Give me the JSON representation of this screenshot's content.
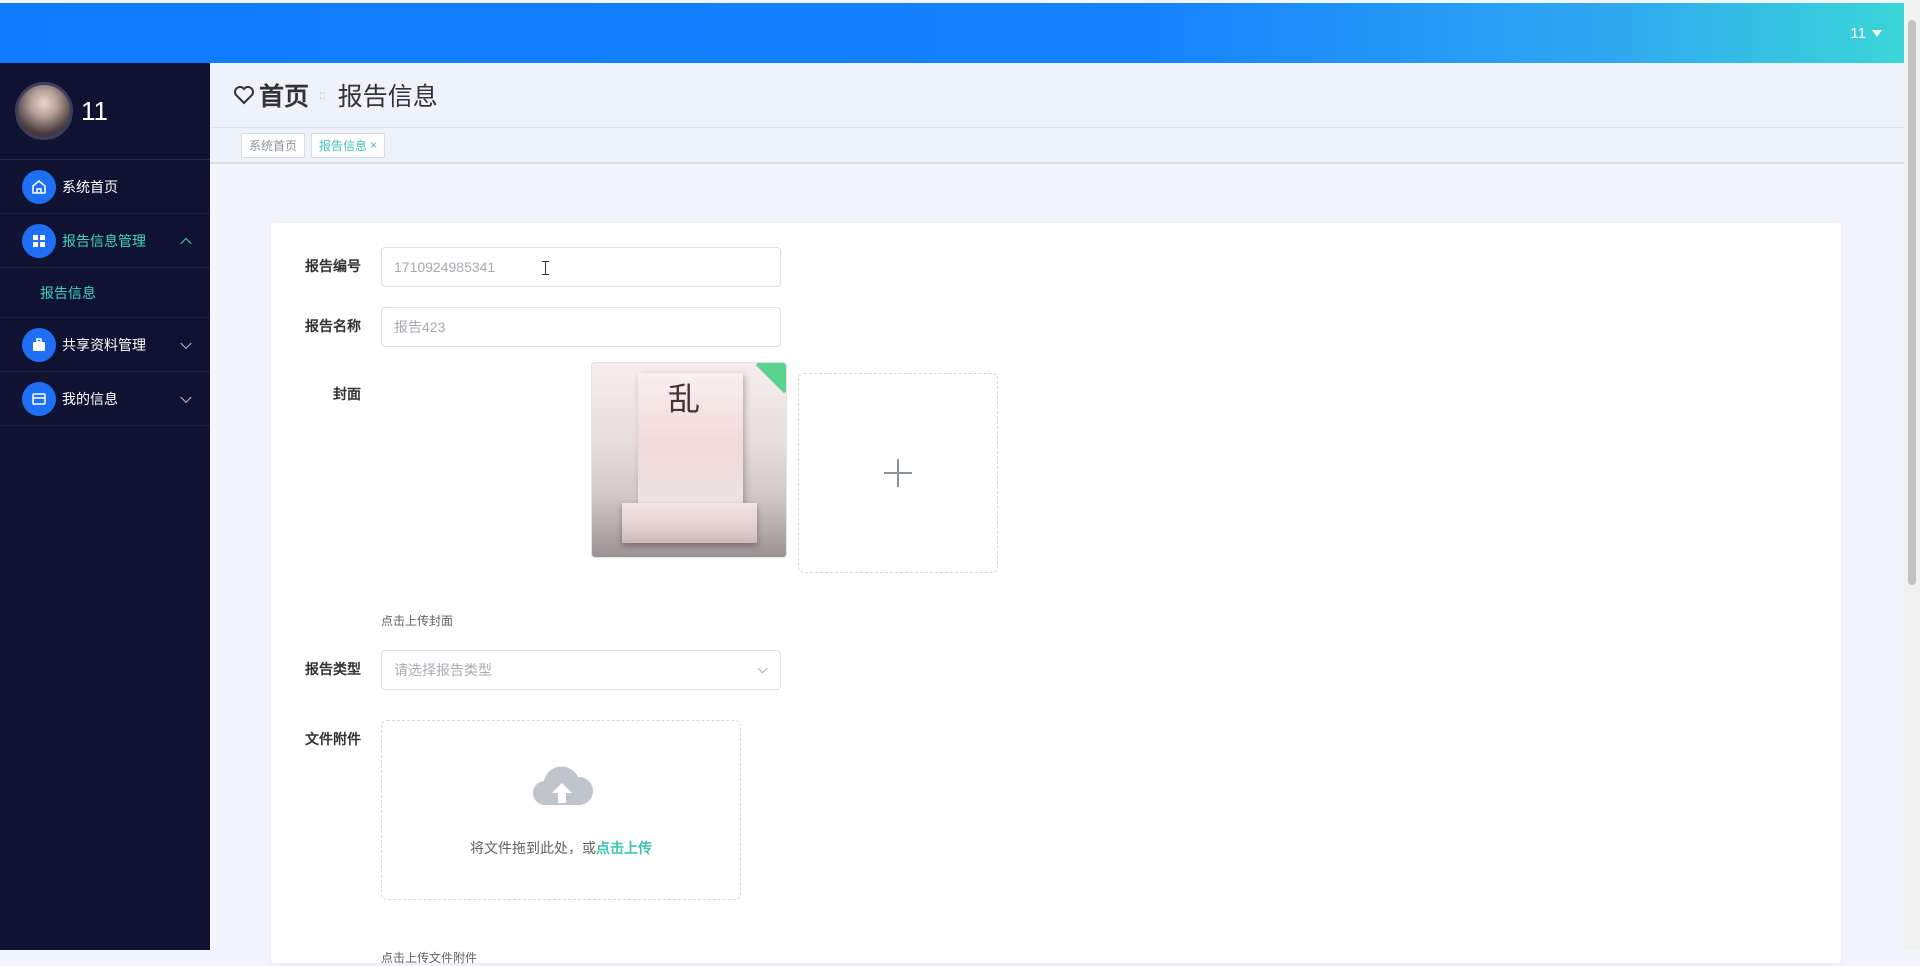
{
  "topbar": {
    "user": "11"
  },
  "sidebar": {
    "profile_name": "11",
    "items": [
      {
        "label": "系统首页",
        "icon": "home-icon"
      },
      {
        "label": "报告信息管理",
        "icon": "grid-icon",
        "children": [
          {
            "label": "报告信息"
          }
        ]
      },
      {
        "label": "共享资料管理",
        "icon": "briefcase-icon"
      },
      {
        "label": "我的信息",
        "icon": "wallet-icon"
      }
    ]
  },
  "breadcrumb": {
    "home": "首页",
    "separator": "::",
    "current": "报告信息"
  },
  "tags": [
    {
      "label": "系统首页"
    },
    {
      "label": "报告信息"
    }
  ],
  "form": {
    "report_no": {
      "label": "报告编号",
      "placeholder": "1710924985341"
    },
    "report_name": {
      "label": "报告名称",
      "placeholder": "报告423"
    },
    "cover": {
      "label": "封面",
      "hint": "点击上传封面",
      "thumb_text": "乱"
    },
    "report_type": {
      "label": "报告类型",
      "placeholder": "请选择报告类型"
    },
    "attachment": {
      "label": "文件附件",
      "drag_text": "将文件拖到此处，或",
      "drag_link": "点击上传",
      "hint": "点击上传文件附件"
    }
  },
  "colors": {
    "accent": "#3fc4b3",
    "primary": "#1e6ff5",
    "sidebar_bg": "#0f1230"
  }
}
